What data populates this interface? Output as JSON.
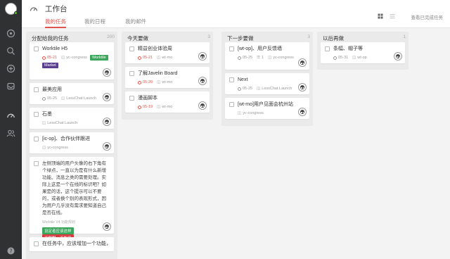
{
  "header": {
    "title": "工作台",
    "tabs": [
      "我的任务",
      "我的日程",
      "我的邮件"
    ],
    "view_completed": "查看已完成任务"
  },
  "columns": [
    {
      "title": "分配给我的任务",
      "count": "200",
      "cards": [
        {
          "title": "Worktile H5",
          "due": "05-21",
          "project": "yc-congress",
          "labels": [
            {
              "text": "Worktile",
              "color": "#3aa55b"
            },
            {
              "text": "Market",
              "color": "#5b3f8f"
            }
          ]
        },
        {
          "title": "最美应用",
          "due": "05-25",
          "due_gray": true,
          "project": "LessChat Launch",
          "labels": []
        },
        {
          "title": "石墨",
          "due": "",
          "project": "LessChat Launch",
          "labels": []
        },
        {
          "title": "[ic-op]、合作伙伴跟进",
          "due": "",
          "project": "yc-congress",
          "labels": []
        },
        {
          "title": "",
          "desc": "左侧顶端的用户头像的右下角有个绿点，一直以为是有什么新增功能、消息之类的需要处理。实际上这是一个在线的标识吧？如果是的话，这个提示可以不要的，或者换个别的表现形式，因为用户几乎没有需求要知道自己是否在线。",
          "source": "Worktile V4 功能规划",
          "labels": [
            {
              "text": "设定者应该这样",
              "color": "#3aa55b"
            },
            {
              "text": "不舒服，不能忍",
              "color": "#d9363e"
            }
          ]
        },
        {
          "title": "在任务中，应该增加一个功能，可以",
          "due": "",
          "project": "",
          "labels": []
        }
      ]
    },
    {
      "title": "今天要做",
      "count": "3",
      "cards": [
        {
          "title": "精益创业体验周",
          "due": "05-21",
          "project": "wt-mo",
          "labels": []
        },
        {
          "title": "了解Javelin Board",
          "due": "05-20",
          "project": "wt-mo",
          "labels": []
        },
        {
          "title": "漫画脚本",
          "due": "05-19",
          "project": "wt-mo",
          "labels": []
        }
      ]
    },
    {
      "title": "下一步要做",
      "count": "3",
      "cards": [
        {
          "title": "[wt-op]、用户反馈墙",
          "due": "05-25",
          "subtasks": "1",
          "project": "yc-congress",
          "labels": []
        },
        {
          "title": "Next",
          "due": "05-25",
          "due_gray": true,
          "project": "LessChat Launch",
          "labels": []
        },
        {
          "title": "[wt-mo]用户见面会杭州站",
          "due": "",
          "project": "yc-congress",
          "labels": []
        }
      ]
    },
    {
      "title": "以后再做",
      "count": "1",
      "cards": [
        {
          "title": "条幅、帽子等",
          "due": "05-31",
          "due_gray": true,
          "project": "wt-op",
          "labels": []
        }
      ]
    }
  ]
}
